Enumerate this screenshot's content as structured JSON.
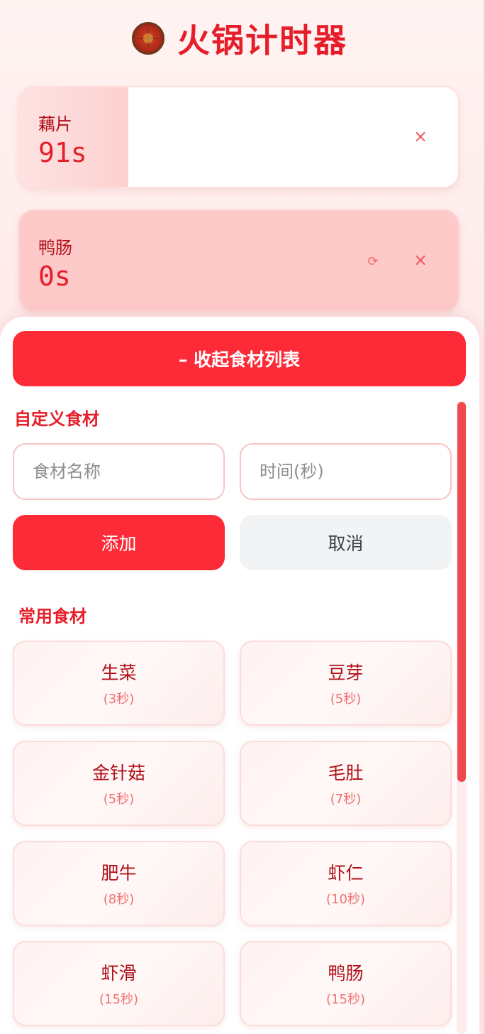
{
  "header": {
    "title": "火锅计时器",
    "icon": "hotpot-icon"
  },
  "timers": [
    {
      "name": "藕片",
      "time": "91s",
      "progress": 0.25,
      "state": "running"
    },
    {
      "name": "鸭肠",
      "time": "0s",
      "progress": 1.0,
      "state": "done"
    }
  ],
  "icons": {
    "close": "×",
    "reset": "⟳"
  },
  "sheet": {
    "collapse_label": "– 收起食材列表",
    "custom_title": "自定义食材",
    "name_placeholder": "食材名称",
    "time_placeholder": "时间(秒)",
    "add_label": "添加",
    "cancel_label": "取消",
    "common_title": "常用食材",
    "foods": [
      {
        "name": "生菜",
        "time": "(3秒)"
      },
      {
        "name": "豆芽",
        "time": "(5秒)"
      },
      {
        "name": "金针菇",
        "time": "(5秒)"
      },
      {
        "name": "毛肚",
        "time": "(7秒)"
      },
      {
        "name": "肥牛",
        "time": "(8秒)"
      },
      {
        "name": "虾仁",
        "time": "(10秒)"
      },
      {
        "name": "虾滑",
        "time": "(15秒)"
      },
      {
        "name": "鸭肠",
        "time": "(15秒)"
      }
    ]
  },
  "colors": {
    "accent": "#fd2b37",
    "title": "#e61e2a",
    "food_name": "#b0101a"
  }
}
